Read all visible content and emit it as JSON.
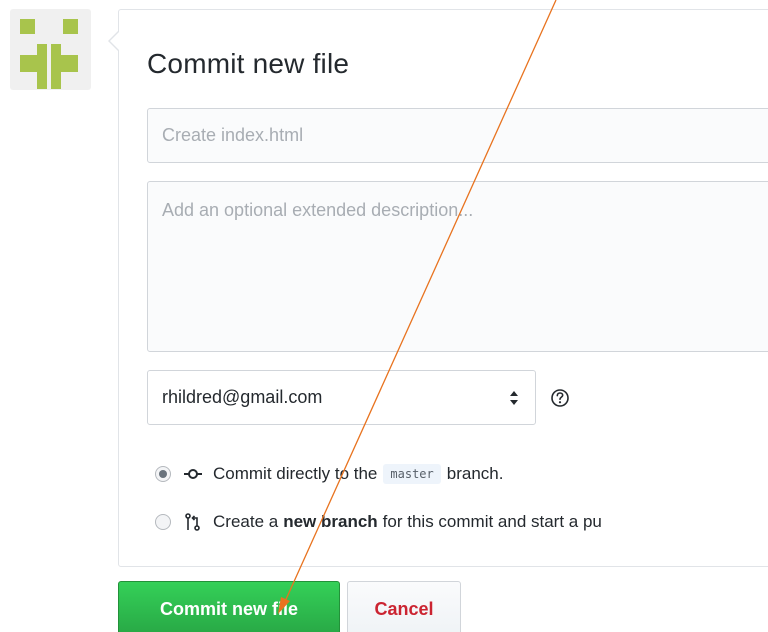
{
  "commit_form": {
    "title": "Commit new file",
    "summary_placeholder": "Create index.html",
    "description_placeholder": "Add an optional extended description...",
    "author_email": "rhildred@gmail.com",
    "options": [
      {
        "prefix": "Commit directly to the",
        "branch": "master",
        "suffix": "branch.",
        "selected": true
      },
      {
        "prefix": "Create a",
        "bold": "new branch",
        "suffix": "for this commit and start a pu",
        "selected": false
      }
    ],
    "commit_button": "Commit new file",
    "cancel_button": "Cancel"
  },
  "colors": {
    "primary_green": "#28a745",
    "cancel_red": "#cb2431",
    "avatar_green": "#a8c44c",
    "annotation_arrow": "#e8731f"
  },
  "icons": {
    "avatar": "identicon-avatar",
    "select": "select-arrows-icon",
    "help": "question-circle-icon",
    "commit": "git-commit-icon",
    "branch": "git-pull-request-icon"
  }
}
